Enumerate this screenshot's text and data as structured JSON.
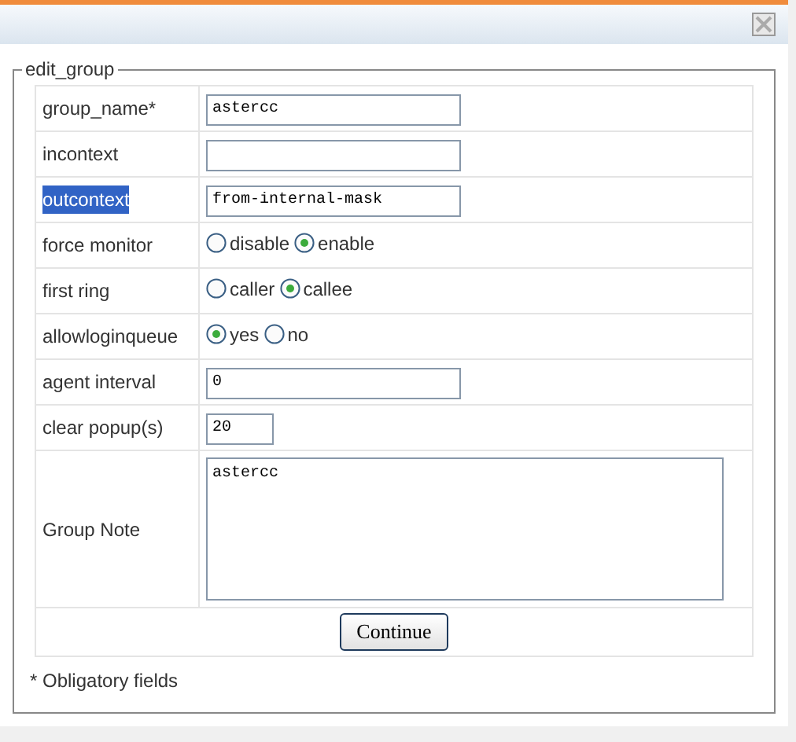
{
  "legend": "edit_group",
  "rows": [
    {
      "kind": "text",
      "label": "group_name*",
      "highlighted": false,
      "value": "astercc"
    },
    {
      "kind": "text",
      "label": "incontext",
      "highlighted": false,
      "value": ""
    },
    {
      "kind": "text",
      "label": "outcontext",
      "highlighted": true,
      "value": "from-internal-mask"
    },
    {
      "kind": "radio",
      "label": "force monitor",
      "highlighted": false,
      "options": [
        {
          "label": "disable",
          "selected": false
        },
        {
          "label": "enable",
          "selected": true
        }
      ]
    },
    {
      "kind": "radio",
      "label": "first ring",
      "highlighted": false,
      "options": [
        {
          "label": "caller",
          "selected": false
        },
        {
          "label": "callee",
          "selected": true
        }
      ]
    },
    {
      "kind": "radio",
      "label": "allowloginqueue",
      "highlighted": false,
      "options": [
        {
          "label": "yes",
          "selected": true
        },
        {
          "label": "no",
          "selected": false
        }
      ]
    },
    {
      "kind": "text",
      "label": "agent interval",
      "highlighted": false,
      "value": "0"
    },
    {
      "kind": "short",
      "label": "clear popup(s)",
      "highlighted": false,
      "value": "20"
    },
    {
      "kind": "textarea",
      "label": "Group Note",
      "highlighted": false,
      "value": "astercc"
    }
  ],
  "button": "Continue",
  "footnote": "* Obligatory fields"
}
